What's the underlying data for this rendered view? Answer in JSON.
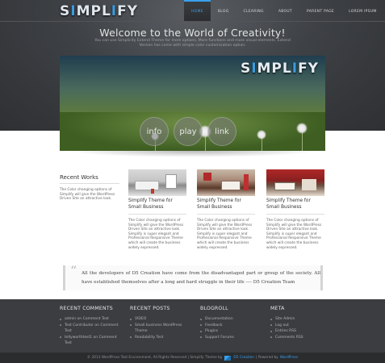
{
  "header": {
    "logo": "SIMPLIFY",
    "nav": [
      {
        "label": "HOME",
        "active": true
      },
      {
        "label": "BLOG",
        "active": false
      },
      {
        "label": "CLEARING",
        "active": false
      },
      {
        "label": "ABOUT",
        "active": false
      },
      {
        "label": "PARENT PAGE",
        "active": false
      },
      {
        "label": "LOREM IPSUM",
        "active": false
      }
    ]
  },
  "hero": {
    "title": "Welcome to the World of Creativity!",
    "intro": "You can use Simplicity Extend Theme for more options, More functions and more visual elements. Extend Version has come with simple color customization option."
  },
  "slider": {
    "logo": "SIMPLIFY",
    "buttons": [
      "info",
      "play",
      "link"
    ]
  },
  "recent": {
    "title": "Recent Works",
    "text": "The Color changing options of Simplify will give the WordPress Driven Site an attractive look."
  },
  "cards": [
    {
      "title": "Simplify Theme for Small Business",
      "text": "The Color changing options of Simplify will give the WordPress Driven Site an attractive look. Simplify is super elegant and Professional Responsive Theme which will create the business widely expressed."
    },
    {
      "title": "Simplify Theme for Small Business",
      "text": "The Color changing options of Simplify will give the WordPress Driven Site an attractive look. Simplify is super elegant and Professional Responsive Theme which will create the business widely expressed."
    },
    {
      "title": "Simplify Theme for Small Business",
      "text": "The Color changing options of Simplify will give the WordPress Driven Site an attractive look. Simplify is super elegant and Professional Responsive Theme which will create the business widely expressed."
    }
  ],
  "quote": {
    "text": "All the developers of D5 Creation have come from the disadvantaged part or group of the society. All have established themselves after a long and hard struggle in their life ---- D5 Creation Team"
  },
  "footer": {
    "columns": [
      {
        "title": "RECENT COMMENTS",
        "items": [
          "admin on Comment Test",
          "Test Contributor on Comment Test",
          "tellyworthtest1 on Comment Test"
        ]
      },
      {
        "title": "RECENT POSTS",
        "items": [
          "VIDEO",
          "Small business WordPress Theme",
          "Readability Test"
        ]
      },
      {
        "title": "BLOGROLL",
        "items": [
          "Documentation",
          "Feedback",
          "Plugins",
          "Support Forums"
        ]
      },
      {
        "title": "META",
        "items": [
          "Site Admin",
          "Log out",
          "Entries RSS",
          "Comments RSS"
        ]
      }
    ],
    "copyright": "© 2013 WordPress Test Environment, All Rights Reserved | Simplify Theme by",
    "credit": "D5 Creation",
    "powered": "| Powered by",
    "wp": "WordPress"
  },
  "colors": {
    "accent": "#3aa0ee",
    "dark": "#3b3d40"
  }
}
